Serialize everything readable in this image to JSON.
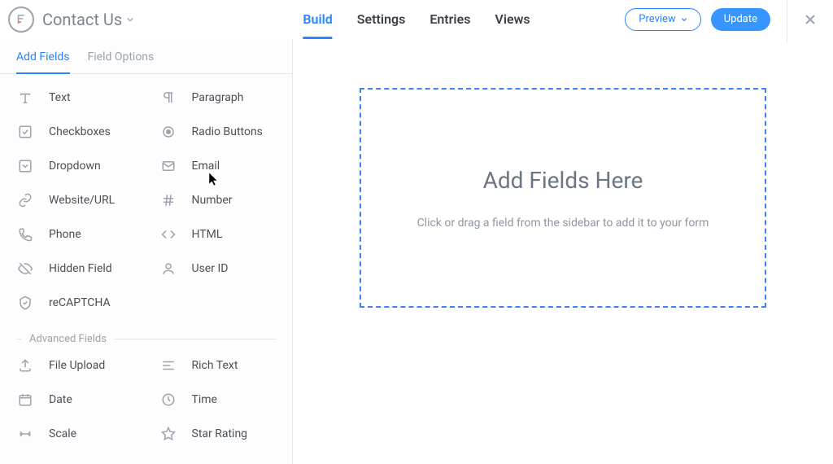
{
  "header": {
    "form_title": "Contact Us",
    "tabs": {
      "build": "Build",
      "settings": "Settings",
      "entries": "Entries",
      "views": "Views"
    },
    "preview_label": "Preview",
    "update_label": "Update"
  },
  "sidebar": {
    "tabs": {
      "add": "Add Fields",
      "options": "Field Options"
    },
    "basic": [
      {
        "label": "Text"
      },
      {
        "label": "Paragraph"
      },
      {
        "label": "Checkboxes"
      },
      {
        "label": "Radio Buttons"
      },
      {
        "label": "Dropdown"
      },
      {
        "label": "Email"
      },
      {
        "label": "Website/URL"
      },
      {
        "label": "Number"
      },
      {
        "label": "Phone"
      },
      {
        "label": "HTML"
      },
      {
        "label": "Hidden Field"
      },
      {
        "label": "User ID"
      },
      {
        "label": "reCAPTCHA"
      }
    ],
    "advanced_heading": "Advanced Fields",
    "advanced": [
      {
        "label": "File Upload"
      },
      {
        "label": "Rich Text"
      },
      {
        "label": "Date"
      },
      {
        "label": "Time"
      },
      {
        "label": "Scale"
      },
      {
        "label": "Star Rating"
      }
    ]
  },
  "canvas": {
    "dropzone_title": "Add Fields Here",
    "dropzone_sub": "Click or drag a field from the sidebar to add it to your form"
  }
}
